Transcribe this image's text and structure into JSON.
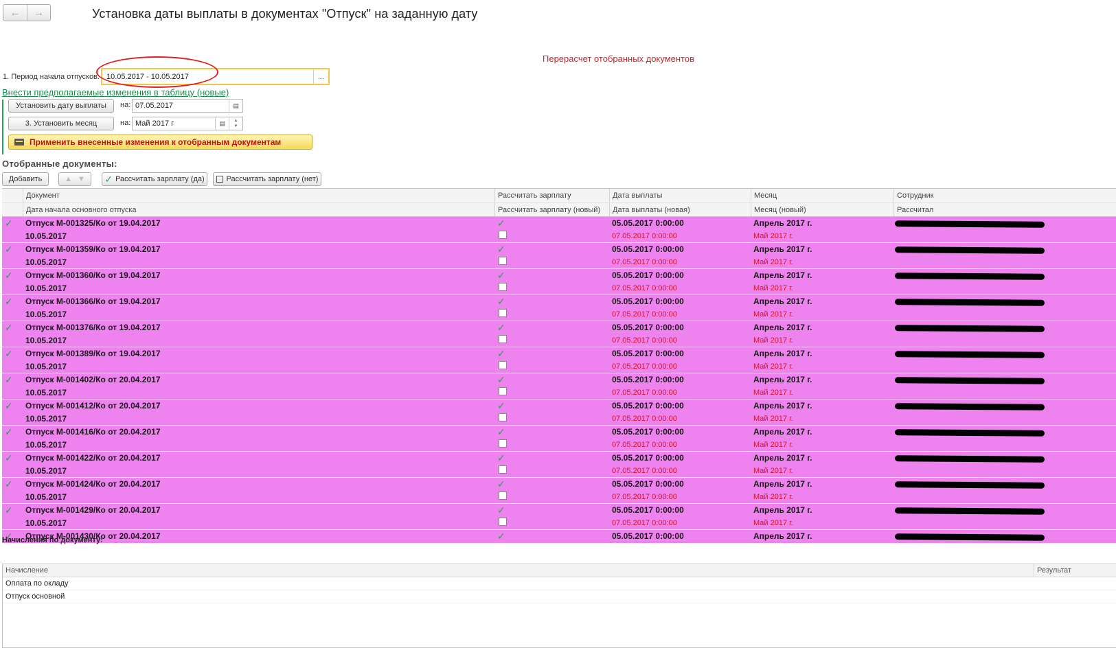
{
  "nav": {
    "back_icon": "←",
    "forward_icon": "→"
  },
  "title": "Установка даты выплаты в документах \"Отпуск\" на заданную дату",
  "recalc_link": "Перерасчет отобранных документов",
  "period": {
    "label": "1. Период начала отпусков:",
    "value": "10.05.2017 - 10.05.2017",
    "dots": "..."
  },
  "changes_link": "Внести предполагаемые изменения в таблицу (новые)",
  "set_date": {
    "button": "Установить дату выплаты",
    "on_label": "на:",
    "value": "07.05.2017"
  },
  "set_month": {
    "button": "3. Установить месяц",
    "on_label": "на:",
    "value": "Май 2017 г"
  },
  "apply_button": "Применить внесенные изменения к отобранным документам",
  "selected_title": "Отобранные документы:",
  "toolbar": {
    "add": "Добавить",
    "calc_yes": "Рассчитать зарплату (да)",
    "calc_no": "Рассчитать зарплату (нет)"
  },
  "columns": {
    "row1": [
      "Документ",
      "Рассчитать зарплату",
      "Дата выплаты",
      "Месяц",
      "Сотрудник"
    ],
    "row2": [
      "Дата начала основного отпуска",
      "Рассчитать зарплату (новый)",
      "Дата выплаты (новая)",
      "Месяц (новый)",
      "Рассчитал"
    ]
  },
  "rows": [
    {
      "doc": "Отпуск М-001325/Ко от 19.04.2017",
      "start": "10.05.2017",
      "pay": "05.05.2017 0:00:00",
      "pay_new": "07.05.2017 0:00:00",
      "month": "Апрель 2017 г.",
      "month_new": "Май 2017 г."
    },
    {
      "doc": "Отпуск М-001359/Ко от 19.04.2017",
      "start": "10.05.2017",
      "pay": "05.05.2017 0:00:00",
      "pay_new": "07.05.2017 0:00:00",
      "month": "Апрель 2017 г.",
      "month_new": "Май 2017 г."
    },
    {
      "doc": "Отпуск М-001360/Ко от 19.04.2017",
      "start": "10.05.2017",
      "pay": "05.05.2017 0:00:00",
      "pay_new": "07.05.2017 0:00:00",
      "month": "Апрель 2017 г.",
      "month_new": "Май 2017 г."
    },
    {
      "doc": "Отпуск М-001366/Ко от 19.04.2017",
      "start": "10.05.2017",
      "pay": "05.05.2017 0:00:00",
      "pay_new": "07.05.2017 0:00:00",
      "month": "Апрель 2017 г.",
      "month_new": "Май 2017 г."
    },
    {
      "doc": "Отпуск М-001376/Ко от 19.04.2017",
      "start": "10.05.2017",
      "pay": "05.05.2017 0:00:00",
      "pay_new": "07.05.2017 0:00:00",
      "month": "Апрель 2017 г.",
      "month_new": "Май 2017 г."
    },
    {
      "doc": "Отпуск М-001389/Ко от 19.04.2017",
      "start": "10.05.2017",
      "pay": "05.05.2017 0:00:00",
      "pay_new": "07.05.2017 0:00:00",
      "month": "Апрель 2017 г.",
      "month_new": "Май 2017 г."
    },
    {
      "doc": "Отпуск М-001402/Ко от 20.04.2017",
      "start": "10.05.2017",
      "pay": "05.05.2017 0:00:00",
      "pay_new": "07.05.2017 0:00:00",
      "month": "Апрель 2017 г.",
      "month_new": "Май 2017 г."
    },
    {
      "doc": "Отпуск М-001412/Ко от 20.04.2017",
      "start": "10.05.2017",
      "pay": "05.05.2017 0:00:00",
      "pay_new": "07.05.2017 0:00:00",
      "month": "Апрель 2017 г.",
      "month_new": "Май 2017 г."
    },
    {
      "doc": "Отпуск М-001416/Ко от 20.04.2017",
      "start": "10.05.2017",
      "pay": "05.05.2017 0:00:00",
      "pay_new": "07.05.2017 0:00:00",
      "month": "Апрель 2017 г.",
      "month_new": "Май 2017 г."
    },
    {
      "doc": "Отпуск М-001422/Ко от 20.04.2017",
      "start": "10.05.2017",
      "pay": "05.05.2017 0:00:00",
      "pay_new": "07.05.2017 0:00:00",
      "month": "Апрель 2017 г.",
      "month_new": "Май 2017 г."
    },
    {
      "doc": "Отпуск М-001424/Ко от 20.04.2017",
      "start": "10.05.2017",
      "pay": "05.05.2017 0:00:00",
      "pay_new": "07.05.2017 0:00:00",
      "month": "Апрель 2017 г.",
      "month_new": "Май 2017 г."
    },
    {
      "doc": "Отпуск М-001429/Ко от 20.04.2017",
      "start": "10.05.2017",
      "pay": "05.05.2017 0:00:00",
      "pay_new": "07.05.2017 0:00:00",
      "month": "Апрель 2017 г.",
      "month_new": "Май 2017 г."
    },
    {
      "doc": "Отпуск М-001430/Ко от 20.04.2017",
      "start": "",
      "pay": "05.05.2017 0:00:00",
      "pay_new": "",
      "month": "Апрель 2017 г.",
      "month_new": ""
    }
  ],
  "accruals": {
    "title": "Начисления по документу:",
    "col_accrual": "Начисление",
    "col_result": "Результат",
    "items": [
      "Оплата по окладу",
      "Отпуск основной"
    ]
  },
  "icons": {
    "check": "✓",
    "calendar": "▤",
    "up": "▲",
    "down": "▼"
  },
  "colors": {
    "row_bg": "#ee82ee",
    "accent_red": "#d4142a",
    "link_green": "#1c8a4a",
    "apply_bg": "#f4d958"
  }
}
